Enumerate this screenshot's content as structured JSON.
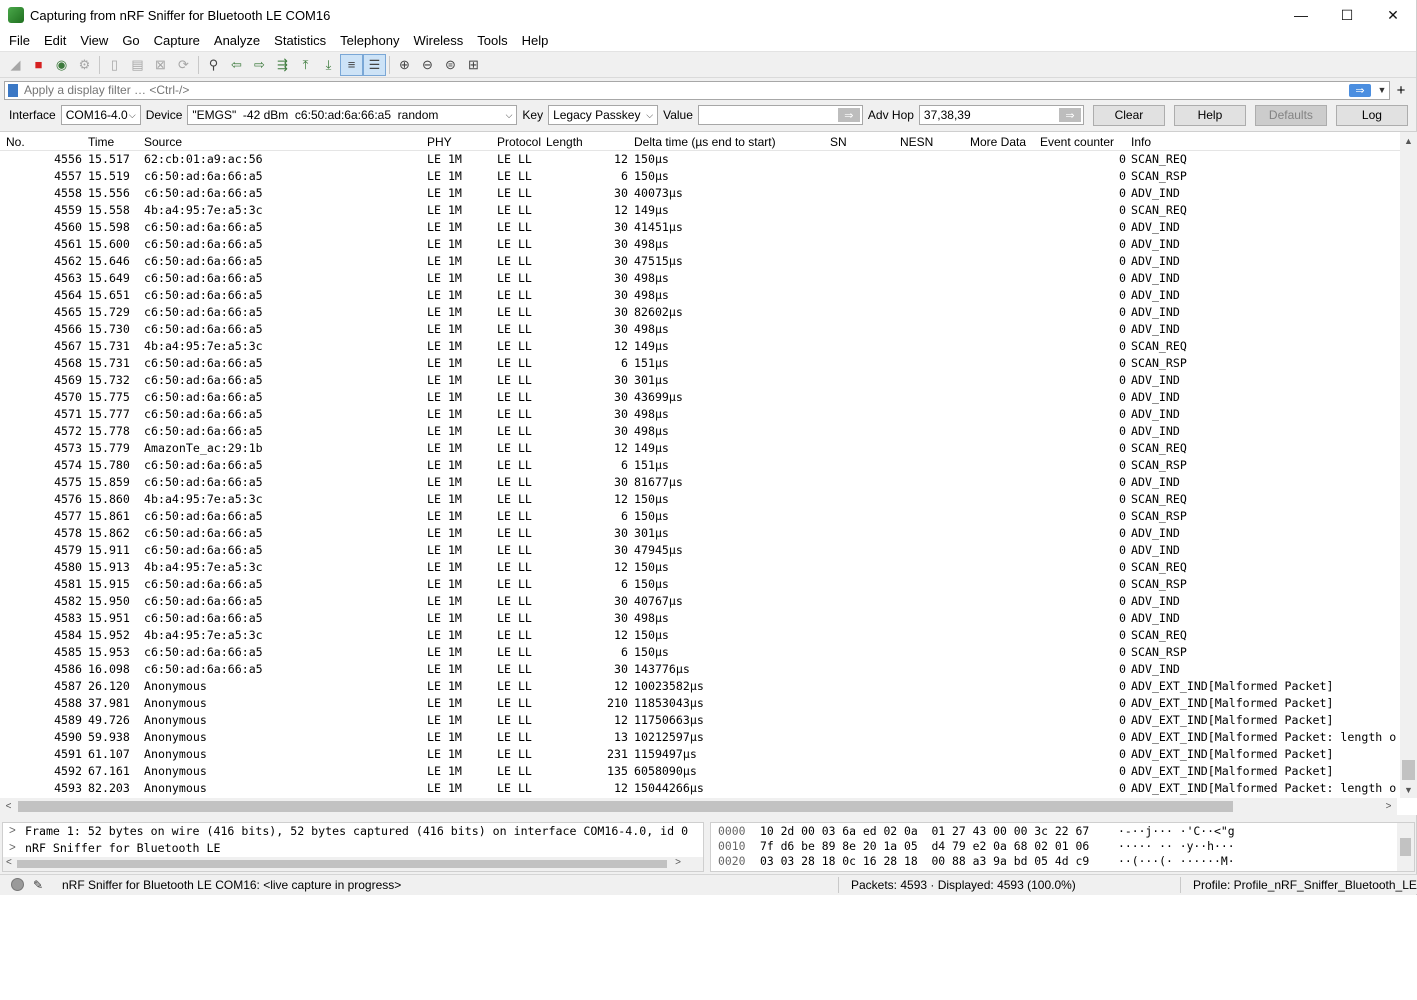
{
  "window": {
    "title": "Capturing from nRF Sniffer for Bluetooth LE COM16",
    "controls": [
      "—",
      "☐",
      "✕"
    ]
  },
  "menu": [
    "File",
    "Edit",
    "View",
    "Go",
    "Capture",
    "Analyze",
    "Statistics",
    "Telephony",
    "Wireless",
    "Tools",
    "Help"
  ],
  "filter": {
    "placeholder": "Apply a display filter … <Ctrl-/>"
  },
  "sniffer": {
    "interface_label": "Interface",
    "interface_value": "COM16-4.0",
    "device_label": "Device",
    "device_value": "\"EMGS\"  -42 dBm  c6:50:ad:6a:66:a5  random",
    "key_label": "Key",
    "key_value": "Legacy Passkey",
    "value_label": "Value",
    "value_value": "",
    "advhop_label": "Adv Hop",
    "advhop_value": "37,38,39",
    "buttons": {
      "clear": "Clear",
      "help": "Help",
      "defaults": "Defaults",
      "log": "Log"
    }
  },
  "columns": {
    "no": "No.",
    "time": "Time",
    "source": "Source",
    "phy": "PHY",
    "protocol": "Protocol",
    "length": "Length",
    "delta": "Delta time (µs end to start)",
    "sn": "SN",
    "nesn": "NESN",
    "more": "More Data",
    "event": "Event counter",
    "info": "Info"
  },
  "packets": [
    [
      "4556",
      "15.517",
      "62:cb:01:a9:ac:56",
      "LE 1M",
      "LE LL",
      "12",
      "150µs",
      "0",
      "SCAN_REQ"
    ],
    [
      "4557",
      "15.519",
      "c6:50:ad:6a:66:a5",
      "LE 1M",
      "LE LL",
      "6",
      "150µs",
      "0",
      "SCAN_RSP"
    ],
    [
      "4558",
      "15.556",
      "c6:50:ad:6a:66:a5",
      "LE 1M",
      "LE LL",
      "30",
      "40073µs",
      "0",
      "ADV_IND"
    ],
    [
      "4559",
      "15.558",
      "4b:a4:95:7e:a5:3c",
      "LE 1M",
      "LE LL",
      "12",
      "149µs",
      "0",
      "SCAN_REQ"
    ],
    [
      "4560",
      "15.598",
      "c6:50:ad:6a:66:a5",
      "LE 1M",
      "LE LL",
      "30",
      "41451µs",
      "0",
      "ADV_IND"
    ],
    [
      "4561",
      "15.600",
      "c6:50:ad:6a:66:a5",
      "LE 1M",
      "LE LL",
      "30",
      "498µs",
      "0",
      "ADV_IND"
    ],
    [
      "4562",
      "15.646",
      "c6:50:ad:6a:66:a5",
      "LE 1M",
      "LE LL",
      "30",
      "47515µs",
      "0",
      "ADV_IND"
    ],
    [
      "4563",
      "15.649",
      "c6:50:ad:6a:66:a5",
      "LE 1M",
      "LE LL",
      "30",
      "498µs",
      "0",
      "ADV_IND"
    ],
    [
      "4564",
      "15.651",
      "c6:50:ad:6a:66:a5",
      "LE 1M",
      "LE LL",
      "30",
      "498µs",
      "0",
      "ADV_IND"
    ],
    [
      "4565",
      "15.729",
      "c6:50:ad:6a:66:a5",
      "LE 1M",
      "LE LL",
      "30",
      "82602µs",
      "0",
      "ADV_IND"
    ],
    [
      "4566",
      "15.730",
      "c6:50:ad:6a:66:a5",
      "LE 1M",
      "LE LL",
      "30",
      "498µs",
      "0",
      "ADV_IND"
    ],
    [
      "4567",
      "15.731",
      "4b:a4:95:7e:a5:3c",
      "LE 1M",
      "LE LL",
      "12",
      "149µs",
      "0",
      "SCAN_REQ"
    ],
    [
      "4568",
      "15.731",
      "c6:50:ad:6a:66:a5",
      "LE 1M",
      "LE LL",
      "6",
      "151µs",
      "0",
      "SCAN_RSP"
    ],
    [
      "4569",
      "15.732",
      "c6:50:ad:6a:66:a5",
      "LE 1M",
      "LE LL",
      "30",
      "301µs",
      "0",
      "ADV_IND"
    ],
    [
      "4570",
      "15.775",
      "c6:50:ad:6a:66:a5",
      "LE 1M",
      "LE LL",
      "30",
      "43699µs",
      "0",
      "ADV_IND"
    ],
    [
      "4571",
      "15.777",
      "c6:50:ad:6a:66:a5",
      "LE 1M",
      "LE LL",
      "30",
      "498µs",
      "0",
      "ADV_IND"
    ],
    [
      "4572",
      "15.778",
      "c6:50:ad:6a:66:a5",
      "LE 1M",
      "LE LL",
      "30",
      "498µs",
      "0",
      "ADV_IND"
    ],
    [
      "4573",
      "15.779",
      "AmazonTe_ac:29:1b",
      "LE 1M",
      "LE LL",
      "12",
      "149µs",
      "0",
      "SCAN_REQ"
    ],
    [
      "4574",
      "15.780",
      "c6:50:ad:6a:66:a5",
      "LE 1M",
      "LE LL",
      "6",
      "151µs",
      "0",
      "SCAN_RSP"
    ],
    [
      "4575",
      "15.859",
      "c6:50:ad:6a:66:a5",
      "LE 1M",
      "LE LL",
      "30",
      "81677µs",
      "0",
      "ADV_IND"
    ],
    [
      "4576",
      "15.860",
      "4b:a4:95:7e:a5:3c",
      "LE 1M",
      "LE LL",
      "12",
      "150µs",
      "0",
      "SCAN_REQ"
    ],
    [
      "4577",
      "15.861",
      "c6:50:ad:6a:66:a5",
      "LE 1M",
      "LE LL",
      "6",
      "150µs",
      "0",
      "SCAN_RSP"
    ],
    [
      "4578",
      "15.862",
      "c6:50:ad:6a:66:a5",
      "LE 1M",
      "LE LL",
      "30",
      "301µs",
      "0",
      "ADV_IND"
    ],
    [
      "4579",
      "15.911",
      "c6:50:ad:6a:66:a5",
      "LE 1M",
      "LE LL",
      "30",
      "47945µs",
      "0",
      "ADV_IND"
    ],
    [
      "4580",
      "15.913",
      "4b:a4:95:7e:a5:3c",
      "LE 1M",
      "LE LL",
      "12",
      "150µs",
      "0",
      "SCAN_REQ"
    ],
    [
      "4581",
      "15.915",
      "c6:50:ad:6a:66:a5",
      "LE 1M",
      "LE LL",
      "6",
      "150µs",
      "0",
      "SCAN_RSP"
    ],
    [
      "4582",
      "15.950",
      "c6:50:ad:6a:66:a5",
      "LE 1M",
      "LE LL",
      "30",
      "40767µs",
      "0",
      "ADV_IND"
    ],
    [
      "4583",
      "15.951",
      "c6:50:ad:6a:66:a5",
      "LE 1M",
      "LE LL",
      "30",
      "498µs",
      "0",
      "ADV_IND"
    ],
    [
      "4584",
      "15.952",
      "4b:a4:95:7e:a5:3c",
      "LE 1M",
      "LE LL",
      "12",
      "150µs",
      "0",
      "SCAN_REQ"
    ],
    [
      "4585",
      "15.953",
      "c6:50:ad:6a:66:a5",
      "LE 1M",
      "LE LL",
      "6",
      "150µs",
      "0",
      "SCAN_RSP"
    ],
    [
      "4586",
      "16.098",
      "c6:50:ad:6a:66:a5",
      "LE 1M",
      "LE LL",
      "30",
      "143776µs",
      "0",
      "ADV_IND"
    ],
    [
      "4587",
      "26.120",
      "Anonymous",
      "LE 1M",
      "LE LL",
      "12",
      "10023582µs",
      "0",
      "ADV_EXT_IND[Malformed Packet]"
    ],
    [
      "4588",
      "37.981",
      "Anonymous",
      "LE 1M",
      "LE LL",
      "210",
      "11853043µs",
      "0",
      "ADV_EXT_IND[Malformed Packet]"
    ],
    [
      "4589",
      "49.726",
      "Anonymous",
      "LE 1M",
      "LE LL",
      "12",
      "11750663µs",
      "0",
      "ADV_EXT_IND[Malformed Packet]"
    ],
    [
      "4590",
      "59.938",
      "Anonymous",
      "LE 1M",
      "LE LL",
      "13",
      "10212597µs",
      "0",
      "ADV_EXT_IND[Malformed Packet: length o"
    ],
    [
      "4591",
      "61.107",
      "Anonymous",
      "LE 1M",
      "LE LL",
      "231",
      "1159497µs",
      "0",
      "ADV_EXT_IND[Malformed Packet]"
    ],
    [
      "4592",
      "67.161",
      "Anonymous",
      "LE 1M",
      "LE LL",
      "135",
      "6058090µs",
      "0",
      "ADV_EXT_IND[Malformed Packet]"
    ],
    [
      "4593",
      "82.203",
      "Anonymous",
      "LE 1M",
      "LE LL",
      "12",
      "15044266µs",
      "0",
      "ADV_EXT_IND[Malformed Packet: length o"
    ]
  ],
  "details": [
    "Frame 1: 52 bytes on wire (416 bits), 52 bytes captured (416 bits) on interface COM16-4.0, id 0",
    "nRF Sniffer for Bluetooth LE"
  ],
  "bytes": [
    {
      "offset": "0000",
      "hex": "10 2d 00 03 6a ed 02 0a  01 27 43 00 00 3c 22 67",
      "ascii": "·-··j··· ·'C··<\"g"
    },
    {
      "offset": "0010",
      "hex": "7f d6 be 89 8e 20 1a 05  d4 79 e2 0a 68 02 01 06",
      "ascii": "····· ·· ·y··h···"
    },
    {
      "offset": "0020",
      "hex": "03 03 28 18 0c 16 28 18  00 88 a3 9a bd 05 4d c9",
      "ascii": "··(···(· ······M·"
    }
  ],
  "status": {
    "message": "nRF Sniffer for Bluetooth LE COM16: <live capture in progress>",
    "packets": "Packets: 4593 · Displayed: 4593 (100.0%)",
    "profile": "Profile: Profile_nRF_Sniffer_Bluetooth_LE"
  }
}
